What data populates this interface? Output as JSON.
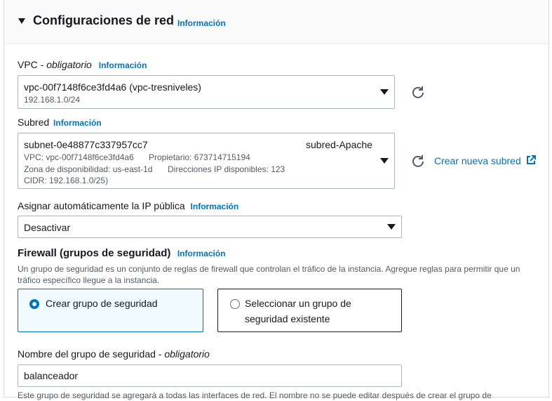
{
  "section": {
    "title": "Configuraciones de red",
    "info": "Información"
  },
  "vpc": {
    "label": "VPC - ",
    "label_required": "obligatorio",
    "info": "Información",
    "value": "vpc-00f7148f6ce3fd4a6 (vpc-tresniveles)",
    "cidr": "192.168.1.0/24"
  },
  "subnet": {
    "label": "Subred",
    "info": "Información",
    "id": "subnet-0e48877c337957cc7",
    "name": "subred-Apache",
    "vpc_line": "VPC: vpc-00f7148f6ce3fd4a6",
    "owner_line": "Propietario: 673714715194",
    "az_line": "Zona de disponibilidad: us-east-1d",
    "ips_line": "Direcciones IP disponibles: 123",
    "cidr_line": "CIDR: 192.168.1.0/25)",
    "create_link": "Crear nueva subred"
  },
  "public_ip": {
    "label": "Asignar automáticamente la IP pública",
    "info": "Información",
    "value": "Desactivar"
  },
  "firewall": {
    "title": "Firewall (grupos de seguridad)",
    "info": "Información",
    "description_1": "Un grupo de seguridad es un conjunto de reglas de firewall que controlan el tráfico de la instancia. Agregue reglas para permitir que un",
    "description_2": "tráfico específico llegue a la instancia.",
    "option_create": "Crear grupo de seguridad",
    "option_select_1": "Seleccionar un grupo de",
    "option_select_2": "seguridad existente",
    "selected": "create"
  },
  "sg_name": {
    "label": "Nombre del grupo de seguridad - ",
    "label_required": "obligatorio",
    "value": "balanceador",
    "note": "Este grupo de seguridad se agregará a todas las interfaces de red. El nombre no se puede editar después de crear el grupo de"
  },
  "colors": {
    "accent": "#0073bb",
    "text": "#16191f",
    "secondary": "#545b64",
    "border": "#aab7b8"
  },
  "icons": [
    "caret-down-icon",
    "chevron-down-icon",
    "refresh-icon",
    "external-link-icon",
    "radio-selected-icon",
    "radio-unselected-icon"
  ]
}
